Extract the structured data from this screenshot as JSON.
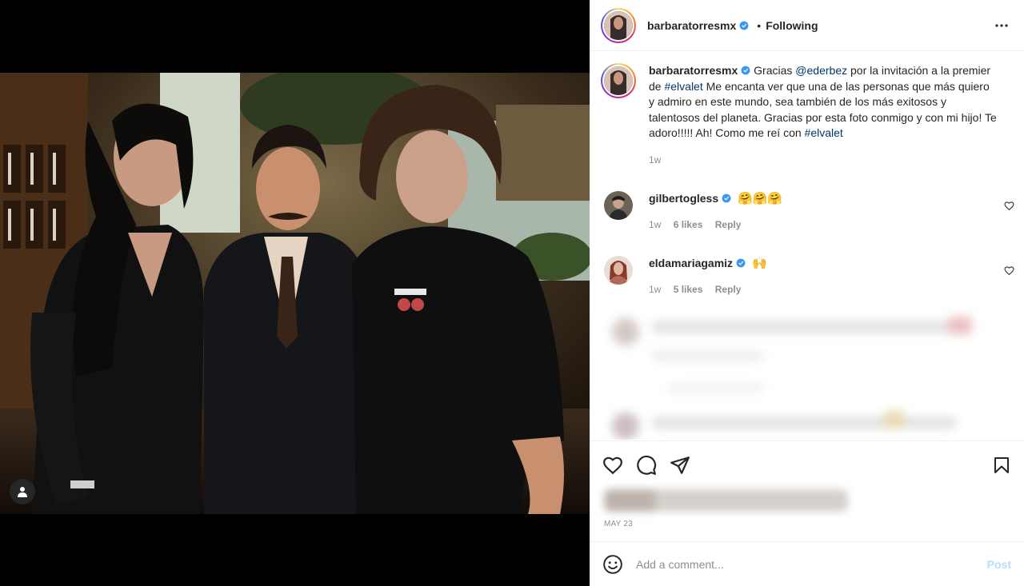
{
  "post": {
    "author": "barbaratorresmx",
    "follow_status": "Following",
    "dot": "•",
    "caption": {
      "username": "barbaratorresmx",
      "t1": "Gracias ",
      "mention": "@ederbez",
      "t2": " por la invitación a la premier de ",
      "hashtag1": "#elvalet",
      "t3": " Me encanta ver que una de las personas que más quiero y admiro en este mundo, sea también de los más exitosos y talentosos del planeta. Gracias por esta foto conmigo y con mi hijo! Te adoro!!!!! Ah! Como me reí con ",
      "hashtag2": "#elvalet",
      "time": "1w"
    },
    "comments": [
      {
        "username": "gilbertogless",
        "text": "🤗🤗🤗",
        "time": "1w",
        "likes": "6 likes",
        "reply": "Reply"
      },
      {
        "username": "eldamariagamiz",
        "text": "🙌",
        "time": "1w",
        "likes": "5 likes",
        "reply": "Reply"
      }
    ],
    "date": "MAY 23",
    "add_comment_placeholder": "Add a comment...",
    "post_label": "Post"
  },
  "icons": {
    "verified": "verified-badge",
    "more": "more-options-icon",
    "like": "heart-icon",
    "comment": "comment-icon",
    "share": "paper-plane-icon",
    "save": "bookmark-icon",
    "emoji": "emoji-smile-icon",
    "user_tags": "user-tags-icon"
  },
  "colors": {
    "link": "#00376b",
    "verified": "#3897f0",
    "post_disabled": "#b2dffc"
  }
}
